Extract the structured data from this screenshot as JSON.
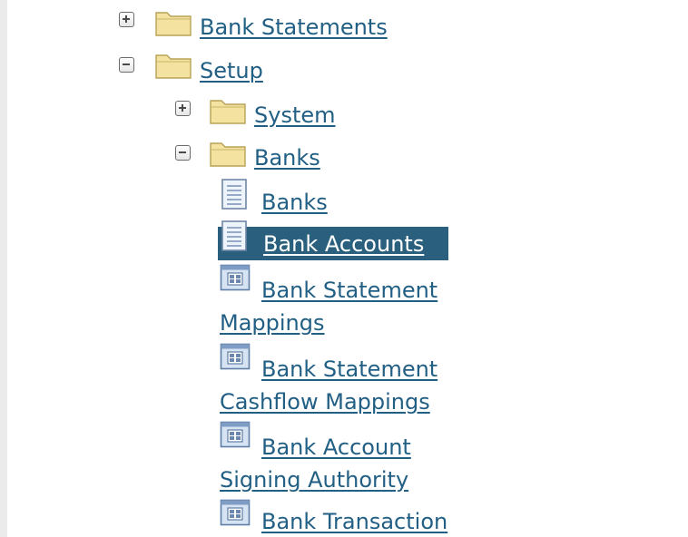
{
  "tree": {
    "bank_statements": {
      "label": "Bank Statements",
      "toggle": "plus-icon",
      "icon": "folder-icon"
    },
    "setup": {
      "label": "Setup",
      "toggle": "minus-icon",
      "icon": "folder-icon"
    },
    "system": {
      "label": "System",
      "toggle": "plus-icon",
      "icon": "folder-icon"
    },
    "banks_folder": {
      "label": "Banks",
      "toggle": "minus-icon",
      "icon": "folder-icon"
    },
    "items": [
      {
        "label": "Banks",
        "icon": "document-icon",
        "selected": false
      },
      {
        "label": "Bank Accounts",
        "icon": "document-icon",
        "selected": true
      },
      {
        "line1": "Bank Statement",
        "line2": "Mappings",
        "icon": "form-icon"
      },
      {
        "line1": "Bank Statement",
        "line2": "Cashflow Mappings",
        "icon": "form-icon"
      },
      {
        "line1": "Bank Account",
        "line2": "Signing Authority",
        "icon": "form-icon"
      },
      {
        "line1": "Bank Transaction",
        "icon": "form-icon"
      }
    ]
  },
  "colors": {
    "link": "#225f84",
    "selection_bg": "#2a607e",
    "folder": "#f0dc8e"
  }
}
